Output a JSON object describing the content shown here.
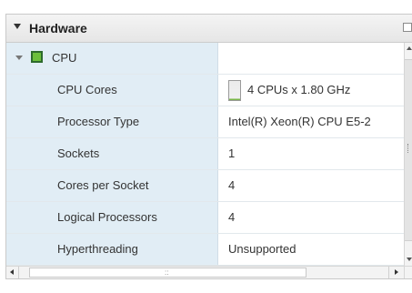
{
  "panel": {
    "title": "Hardware"
  },
  "cpu_group": {
    "label": "CPU"
  },
  "rows": [
    {
      "label": "CPU Cores",
      "value": "4 CPUs x 1.80 GHz",
      "meter_fill": 0.08
    },
    {
      "label": "Processor Type",
      "value": "Intel(R) Xeon(R) CPU E5-2"
    },
    {
      "label": "Sockets",
      "value": "1"
    },
    {
      "label": "Cores per Socket",
      "value": "4"
    },
    {
      "label": "Logical Processors",
      "value": "4"
    },
    {
      "label": "Hyperthreading",
      "value": "Unsupported"
    }
  ],
  "icons": {
    "panel_collapse": "caret-down-icon",
    "panel_maximize": "maximize-icon",
    "group_expand": "chevron-down-icon",
    "cpu": "chip-icon",
    "usage_meter": "usage-meter-icon"
  },
  "colors": {
    "label_column_bg": "#e1edf5",
    "meter_fill": "#7ab648",
    "cpu_icon": "#6cbf3c"
  },
  "scrollbars": {
    "horizontal_grip": "::"
  }
}
